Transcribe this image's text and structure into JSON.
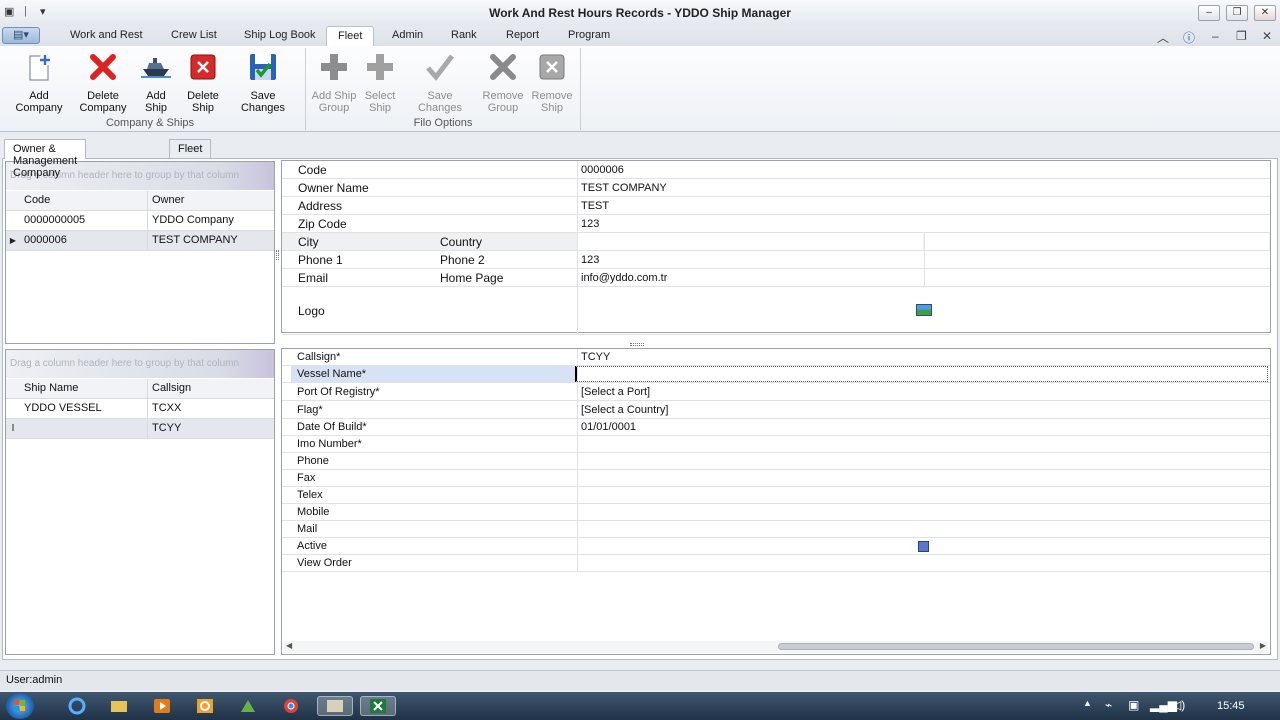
{
  "window": {
    "title": "Work And Rest Hours Records - YDDO Ship Manager"
  },
  "ribbon": {
    "tabs": [
      "Work and Rest",
      "Crew List",
      "Ship Log Book",
      "Fleet",
      "Admin",
      "Rank",
      "Report",
      "Program"
    ],
    "active_tab": "Fleet",
    "group_company": {
      "label": "Company & Ships",
      "buttons": [
        {
          "label": "Add Company",
          "icon": "add-document-icon"
        },
        {
          "label": "Delete Company",
          "icon": "red-x-icon"
        },
        {
          "label": "Add Ship",
          "icon": "ship-icon"
        },
        {
          "label": "Delete Ship",
          "icon": "delete-ship-icon"
        },
        {
          "label": "Save Changes",
          "icon": "save-icon"
        }
      ]
    },
    "group_filo": {
      "label": "Filo Options",
      "buttons": [
        {
          "label": "Add Ship Group",
          "icon": "plus-icon"
        },
        {
          "label": "Select Ship",
          "icon": "plus-icon"
        },
        {
          "label": "Save Changes",
          "icon": "check-icon"
        },
        {
          "label": "Remove Group",
          "icon": "x-icon"
        },
        {
          "label": "Remove Ship",
          "icon": "remove-icon"
        }
      ]
    }
  },
  "subtabs": [
    "Owner & Management Company",
    "Fleet"
  ],
  "company_grid": {
    "group_hint": "Drag a column header here to group by that column",
    "columns": [
      "Code",
      "Owner"
    ],
    "rows": [
      {
        "code": "0000000005",
        "owner": "YDDO Company"
      },
      {
        "code": "0000006",
        "owner": "TEST COMPANY"
      }
    ]
  },
  "company_detail": {
    "code_label": "Code",
    "code_value": "0000006",
    "owner_label": "Owner Name",
    "owner_value": "TEST COMPANY",
    "address_label": "Address",
    "address_value": "TEST",
    "zip_label": "Zip Code",
    "zip_value": "123",
    "city_label": "City",
    "country_label": "Country",
    "phone1_label": "Phone 1",
    "phone2_label": "Phone 2",
    "phone2_value": "123",
    "email_label": "Email",
    "homepage_label": "Home Page",
    "email_value": "info@yddo.com.tr",
    "logo_label": "Logo"
  },
  "ship_grid": {
    "group_hint": "Drag a column header here to group by that column",
    "columns": [
      "Ship Name",
      "Callsign"
    ],
    "rows": [
      {
        "name": "YDDO VESSEL",
        "callsign": "TCXX"
      },
      {
        "name": "",
        "callsign": "TCYY"
      }
    ]
  },
  "ship_detail": {
    "fields": [
      {
        "label": "Callsign*",
        "value": "TCYY"
      },
      {
        "label": "Vessel Name*",
        "value": ""
      },
      {
        "label": "Port Of Registry*",
        "value": "[Select a Port]"
      },
      {
        "label": "Flag*",
        "value": "[Select a Country]"
      },
      {
        "label": "Date Of Build*",
        "value": "01/01/0001"
      },
      {
        "label": "Imo Number*",
        "value": ""
      },
      {
        "label": "Phone",
        "value": ""
      },
      {
        "label": "Fax",
        "value": ""
      },
      {
        "label": "Telex",
        "value": ""
      },
      {
        "label": "Mobile",
        "value": ""
      },
      {
        "label": "Mail",
        "value": ""
      },
      {
        "label": "Active",
        "value": ""
      },
      {
        "label": "View Order",
        "value": ""
      }
    ]
  },
  "status": {
    "user": "User:admin"
  },
  "taskbar": {
    "clock": "15:45"
  }
}
